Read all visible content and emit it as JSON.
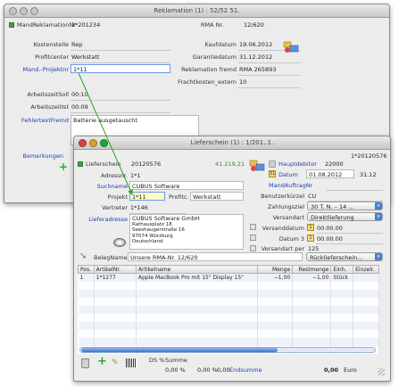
{
  "reklamation": {
    "title": "Reklamation (1) : 52/52 51.",
    "nr_label": "MandReklamationNr",
    "nr_value": "1*201234",
    "kostenstelle_label": "Kostenstelle",
    "kostenstelle_value": "Rep",
    "profitcenter_label": "Profitcenter",
    "profitcenter_value": "Werkstatt",
    "projektnr_label": "Mand.-Projektnr",
    "projektnr_value": "1*11",
    "arbeitszeit_soll_label": "ArbeitszeitSoll",
    "arbeitszeit_soll_value": "00:10",
    "arbeitszeit_ist_label": "ArbeitszeitIst",
    "arbeitszeit_ist_value": "00:09",
    "fehlertext_label": "FehlertextFremd",
    "fehlertext_value": "Batterie ausgetauscht",
    "bemerkungen_label": "Bemerkungen",
    "rma_label": "RMA Nr.",
    "rma_value": "12/620",
    "kaufdatum_label": "Kaufdatum",
    "kaufdatum_value": "19.06.2012",
    "garantiedatum_label": "Garantiedatum",
    "garantiedatum_value": "31.12.2012",
    "rmanr_fremd_label": "Reklamation fremd",
    "rmanr_fremd_value": "RMA 265893",
    "frachtkosten_label": "Frachtkosten_extern",
    "frachtkosten_value": "10"
  },
  "lieferschein": {
    "title": "Lieferschein (1) : 1/201..1.",
    "top_right": "1*20120576",
    "nr_label": "Lieferschein",
    "nr_value": "20120576",
    "amount": "41.219,21",
    "adressnr_label": "Adressnr.",
    "adressnr_value": "1*1",
    "suchname_label": "Suchname",
    "suchname_value": "CUBUS Software",
    "projekt_label": "Projekt",
    "projekt_value": "1*11",
    "profitcenter_label": "Profitc.",
    "profitcenter_value": "Werkstatt",
    "vertreter_label": "Vertreter",
    "vertreter_value": "1*146",
    "lieferadresse_label": "Lieferadresse",
    "address_lines": [
      "CUBUS Software GmbH",
      "Rathausplatz 18",
      "Seeshaugerstraße 16",
      "97074 Würzburg",
      "Deutschland"
    ],
    "hauptdebitor_label": "Hauptdebitor",
    "hauptdebitor_value": "22000",
    "datum_label": "Datum",
    "datum_value": "01.08.2012",
    "kw_value": "31.12",
    "mandauftrag_label": "MandAuftragNr",
    "benutzer_label": "Benutzerkürzel",
    "benutzer_value": "CU",
    "zahlungsziel_label": "Zahlungsziel",
    "zahlungsziel_value": "30 T. N. – 14 ...",
    "versandart_label": "Versandart",
    "versandart_value": "Direktlieferung",
    "versanddatum_label": "Versanddatum",
    "versanddatum_value": "00.00.00",
    "datum3_label": "Datum 3",
    "datum3_value": "00.00.00",
    "versandart2_label": "Versandart per",
    "versandart2_value": "125",
    "belegname_label": "BelegName",
    "belegname_value": "Unsere RMA-Nr. 12/620",
    "belegart_value": "Rücklieferschein...",
    "columns": [
      "Pos.",
      "ArtikelNr.",
      "Artikelname",
      "Menge",
      "Restmenge",
      "Einh.",
      "Einzelr."
    ],
    "rows": [
      [
        "1",
        "1*1277",
        "Apple MacBook Pro mit 15\" Display 15\"",
        "−1,00",
        "−1,00",
        "Stück",
        ""
      ]
    ],
    "summe_label": "Summe",
    "ds_label": "DS %",
    "summe_value": "0,00",
    "endsumme_label": "Endsumme",
    "endsumme_value": "0,00",
    "currency": "Euro",
    "percent1": "0,00 %",
    "percent2": "0,00 %"
  },
  "colors": {
    "link": "#1f3fb0",
    "arrow": "#22aa22",
    "amount": "#2a8a2a"
  },
  "icons": [
    "green-square-icon",
    "window-close-icon",
    "window-minimize-icon",
    "window-zoom-icon",
    "address-book-icon",
    "plus-icon",
    "trash-icon",
    "disk-icon",
    "pen-icon"
  ]
}
